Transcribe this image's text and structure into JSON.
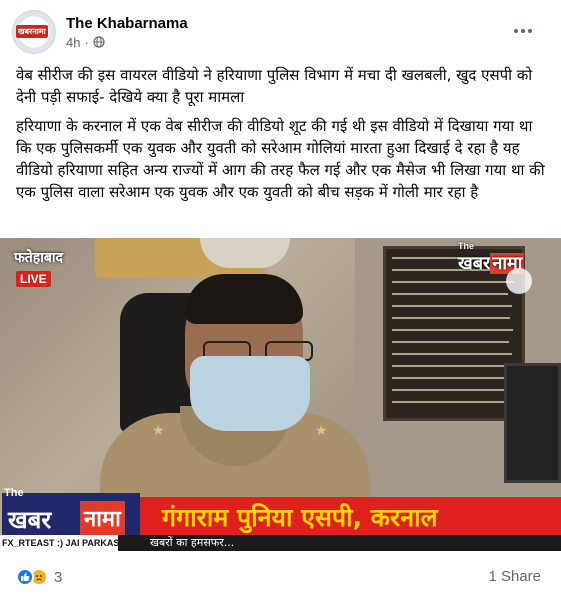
{
  "post": {
    "page_name": "The Khabarnama",
    "time": "4h",
    "separator": "·",
    "headline": "वेब सीरीज की इस वायरल वीडियो ने हरियाणा पुलिस विभाग में मचा दी खलबली, खुद एसपी को देनी पड़ी सफाई- देखिये क्या है पूरा मामला",
    "body": "हरियाणा के करनाल में एक वेब सीरीज की वीडियो शूट की गई थी इस वीडियो में दिखाया गया था कि एक पुलिसकर्मी एक युवक और युवती को सरेआम गोलियां मारता हुआ दिखाई दे रहा है यह वीडियो हरियाणा सहित अन्य राज्यों में आग की तरह फैल गई और एक मैसेज भी लिखा गया था की एक पुलिस वाला सरेआम एक युवक और एक युवती को बीच सड़क में गोली मार रहा है"
  },
  "avatar": {
    "logo_text": "खबरनामा"
  },
  "video": {
    "location": "फतेहाबाद",
    "live": "LIVE",
    "brand_the": "The",
    "brand_part1": "खबर",
    "brand_part2": "नामा",
    "name_caption": "गंगाराम पुनिया एसपी, करनाल",
    "ticker_left": "FX_RTEAST :) JAI PARKASH",
    "ticker_right": "खबरों का हमसफर..."
  },
  "footer": {
    "reaction_count": "3",
    "share_text": "1 Share"
  },
  "colors": {
    "like_blue": "#1877f2",
    "sad_yellow": "#f7b125",
    "band_red": "#e0201c",
    "caption_yellow": "#ffd700",
    "brand_navy": "#21286b"
  }
}
